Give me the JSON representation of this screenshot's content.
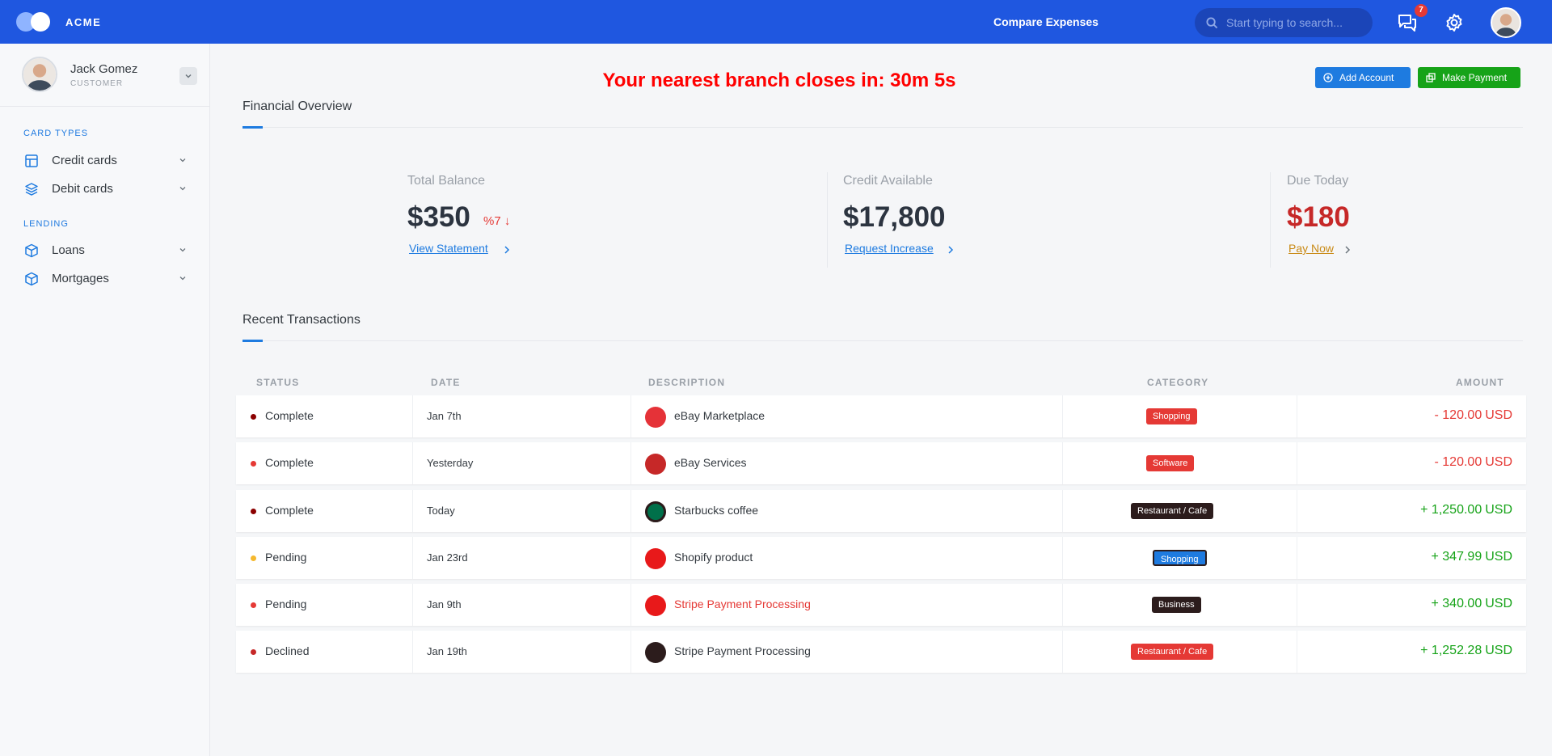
{
  "app": {
    "brand": "ACME",
    "title": "Compare Expenses",
    "notifications": "7"
  },
  "search": {
    "placeholder": "Start typing to search..."
  },
  "user": {
    "name": "Jack Gomez",
    "role": "CUSTOMER"
  },
  "sidebar": {
    "sections": [
      {
        "label": "CARD TYPES",
        "items": [
          {
            "label": "Credit cards",
            "icon": "layout-icon"
          },
          {
            "label": "Debit cards",
            "icon": "layers-icon"
          }
        ]
      },
      {
        "label": "LENDING",
        "items": [
          {
            "label": "Loans",
            "icon": "package-icon"
          },
          {
            "label": "Mortgages",
            "icon": "package-icon"
          }
        ]
      }
    ]
  },
  "countdown": "Your nearest branch closes in: 30m 5s",
  "actions": {
    "add_account": "Add Account",
    "make_payment": "Make Payment"
  },
  "overview": {
    "title": "Financial Overview",
    "stats": [
      {
        "label": "Total Balance",
        "value": "$350",
        "trend": "%7",
        "link": "View Statement"
      },
      {
        "label": "Credit Available",
        "value": "$17,800",
        "link": "Request Increase"
      },
      {
        "label": "Due Today",
        "value": "$180",
        "link": "Pay Now"
      }
    ]
  },
  "transactions": {
    "title": "Recent Transactions",
    "columns": [
      "STATUS",
      "DATE",
      "DESCRIPTION",
      "CATEGORY",
      "AMOUNT"
    ],
    "rows": [
      {
        "status": "Complete",
        "date": "Jan 7th",
        "description": "eBay Marketplace",
        "category": "Shopping",
        "amount": "- 120.00",
        "currency": "USD",
        "direction": "out"
      },
      {
        "status": "Complete",
        "date": "Yesterday",
        "description": "eBay Services",
        "category": "Software",
        "amount": "- 120.00",
        "currency": "USD",
        "direction": "out"
      },
      {
        "status": "Complete",
        "date": "Today",
        "description": "Starbucks coffee",
        "category": "Restaurant / Cafe",
        "amount": "+ 1,250.00",
        "currency": "USD",
        "direction": "in"
      },
      {
        "status": "Pending",
        "date": "Jan 23rd",
        "description": "Shopify product",
        "category": "Shopping",
        "amount": "+ 347.99",
        "currency": "USD",
        "direction": "in"
      },
      {
        "status": "Pending",
        "date": "Jan 9th",
        "description": "Stripe Payment Processing",
        "category": "Business",
        "amount": "+ 340.00",
        "currency": "USD",
        "direction": "in"
      },
      {
        "status": "Declined",
        "date": "Jan 19th",
        "description": "Stripe Payment Processing",
        "category": "Restaurant / Cafe",
        "amount": "+ 1,252.28",
        "currency": "USD",
        "direction": "in"
      }
    ]
  },
  "colors": {
    "primary": "#1f57e0",
    "accent": "#1e7be0",
    "success": "#16a318",
    "danger": "#e53935",
    "warning": "#c98a15",
    "pending": "#f5b82e"
  }
}
